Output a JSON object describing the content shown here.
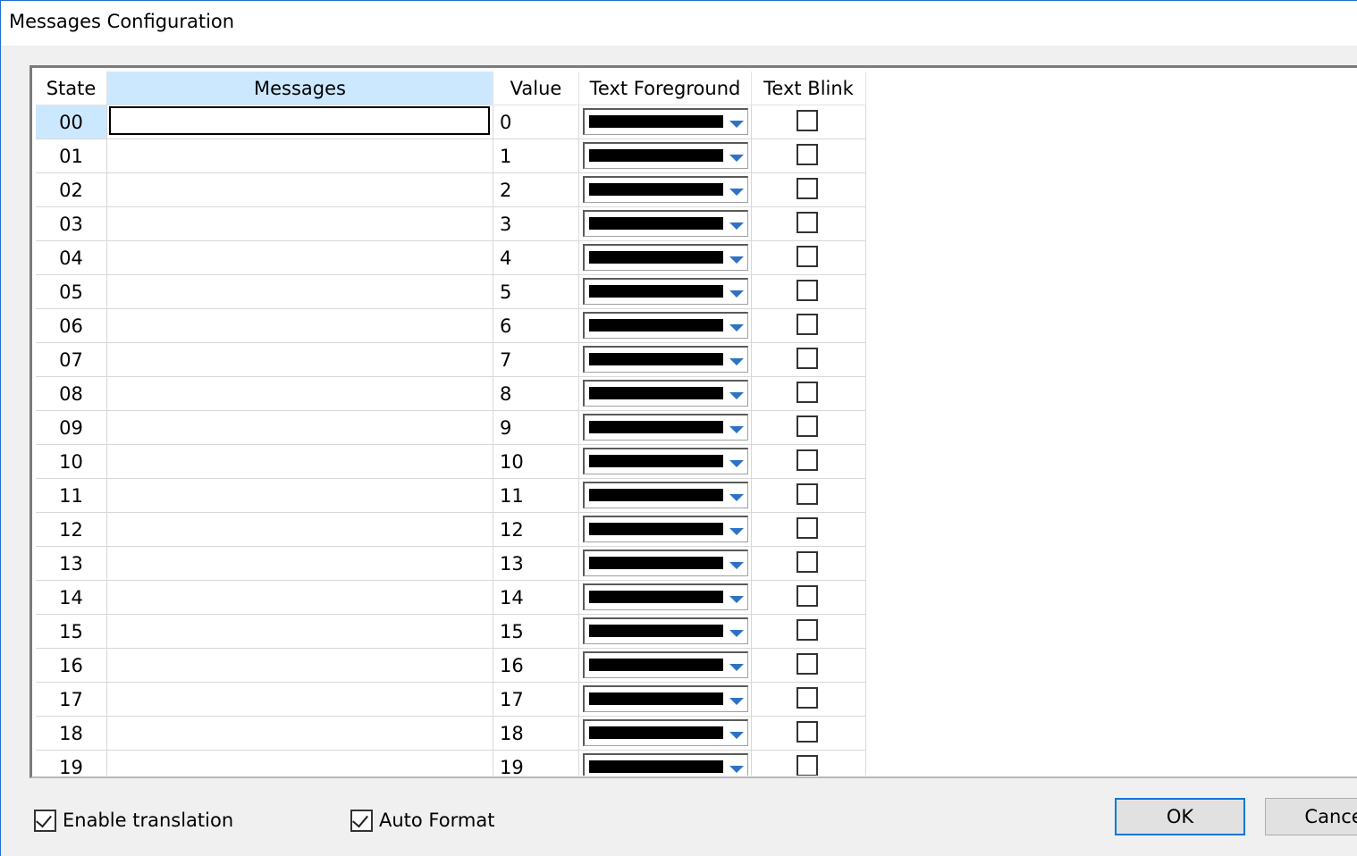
{
  "window": {
    "title": "Messages Configuration"
  },
  "grid": {
    "columns": [
      {
        "label": "State"
      },
      {
        "label": "Messages"
      },
      {
        "label": "Value"
      },
      {
        "label": "Text Foreground"
      },
      {
        "label": "Text Blink"
      }
    ],
    "rows": [
      {
        "state": "00",
        "message": "",
        "value": "0",
        "foreground": "#000000",
        "blink": false
      },
      {
        "state": "01",
        "message": "",
        "value": "1",
        "foreground": "#000000",
        "blink": false
      },
      {
        "state": "02",
        "message": "",
        "value": "2",
        "foreground": "#000000",
        "blink": false
      },
      {
        "state": "03",
        "message": "",
        "value": "3",
        "foreground": "#000000",
        "blink": false
      },
      {
        "state": "04",
        "message": "",
        "value": "4",
        "foreground": "#000000",
        "blink": false
      },
      {
        "state": "05",
        "message": "",
        "value": "5",
        "foreground": "#000000",
        "blink": false
      },
      {
        "state": "06",
        "message": "",
        "value": "6",
        "foreground": "#000000",
        "blink": false
      },
      {
        "state": "07",
        "message": "",
        "value": "7",
        "foreground": "#000000",
        "blink": false
      },
      {
        "state": "08",
        "message": "",
        "value": "8",
        "foreground": "#000000",
        "blink": false
      },
      {
        "state": "09",
        "message": "",
        "value": "9",
        "foreground": "#000000",
        "blink": false
      },
      {
        "state": "10",
        "message": "",
        "value": "10",
        "foreground": "#000000",
        "blink": false
      },
      {
        "state": "11",
        "message": "",
        "value": "11",
        "foreground": "#000000",
        "blink": false
      },
      {
        "state": "12",
        "message": "",
        "value": "12",
        "foreground": "#000000",
        "blink": false
      },
      {
        "state": "13",
        "message": "",
        "value": "13",
        "foreground": "#000000",
        "blink": false
      },
      {
        "state": "14",
        "message": "",
        "value": "14",
        "foreground": "#000000",
        "blink": false
      },
      {
        "state": "15",
        "message": "",
        "value": "15",
        "foreground": "#000000",
        "blink": false
      },
      {
        "state": "16",
        "message": "",
        "value": "16",
        "foreground": "#000000",
        "blink": false
      },
      {
        "state": "17",
        "message": "",
        "value": "17",
        "foreground": "#000000",
        "blink": false
      },
      {
        "state": "18",
        "message": "",
        "value": "18",
        "foreground": "#000000",
        "blink": false
      },
      {
        "state": "19",
        "message": "",
        "value": "19",
        "foreground": "#000000",
        "blink": false
      }
    ]
  },
  "footer": {
    "enable_translation": {
      "label": "Enable translation",
      "checked": true
    },
    "auto_format": {
      "label": "Auto Format",
      "checked": true
    },
    "ok_label": "OK",
    "cancel_label": "Cancel"
  },
  "colors": {
    "selection": "#cce8ff",
    "accent": "#0078d7",
    "dropdown_arrow": "#2f72c4"
  },
  "icons": {
    "dropdown": "chevron-down-icon",
    "checkbox": "checkbox-icon",
    "checkmark": "checkmark-icon"
  }
}
